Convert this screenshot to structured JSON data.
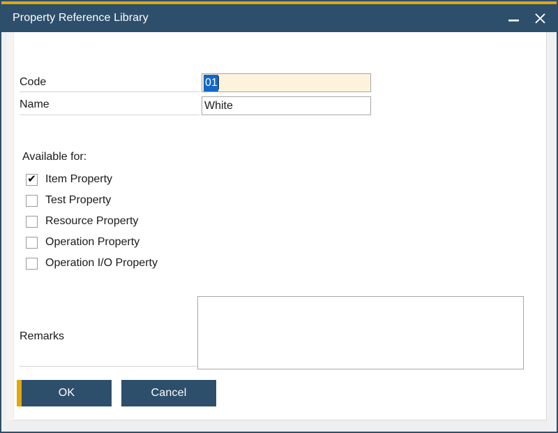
{
  "window": {
    "title": "Property Reference Library",
    "accent_color": "#e0a80f",
    "chrome_color": "#2e4f6b",
    "controls": {
      "minimize_label": "Minimize",
      "close_label": "Close"
    }
  },
  "form": {
    "code": {
      "label": "Code",
      "value": "01",
      "placeholder": "",
      "selected": true,
      "active_background": "#fdf3dd",
      "selection_color": "#1068c8"
    },
    "name": {
      "label": "Name",
      "value": "White",
      "placeholder": ""
    }
  },
  "available_for": {
    "title": "Available for:",
    "checkmark_glyph": "✔",
    "options": [
      {
        "label": "Item Property",
        "checked": true
      },
      {
        "label": "Test Property",
        "checked": false
      },
      {
        "label": "Resource Property",
        "checked": false
      },
      {
        "label": "Operation Property",
        "checked": false
      },
      {
        "label": "Operation I/O Property",
        "checked": false
      }
    ]
  },
  "remarks": {
    "label": "Remarks",
    "value": "",
    "placeholder": ""
  },
  "buttons": {
    "ok": {
      "label": "OK",
      "is_default": true
    },
    "cancel": {
      "label": "Cancel",
      "is_default": false
    }
  }
}
